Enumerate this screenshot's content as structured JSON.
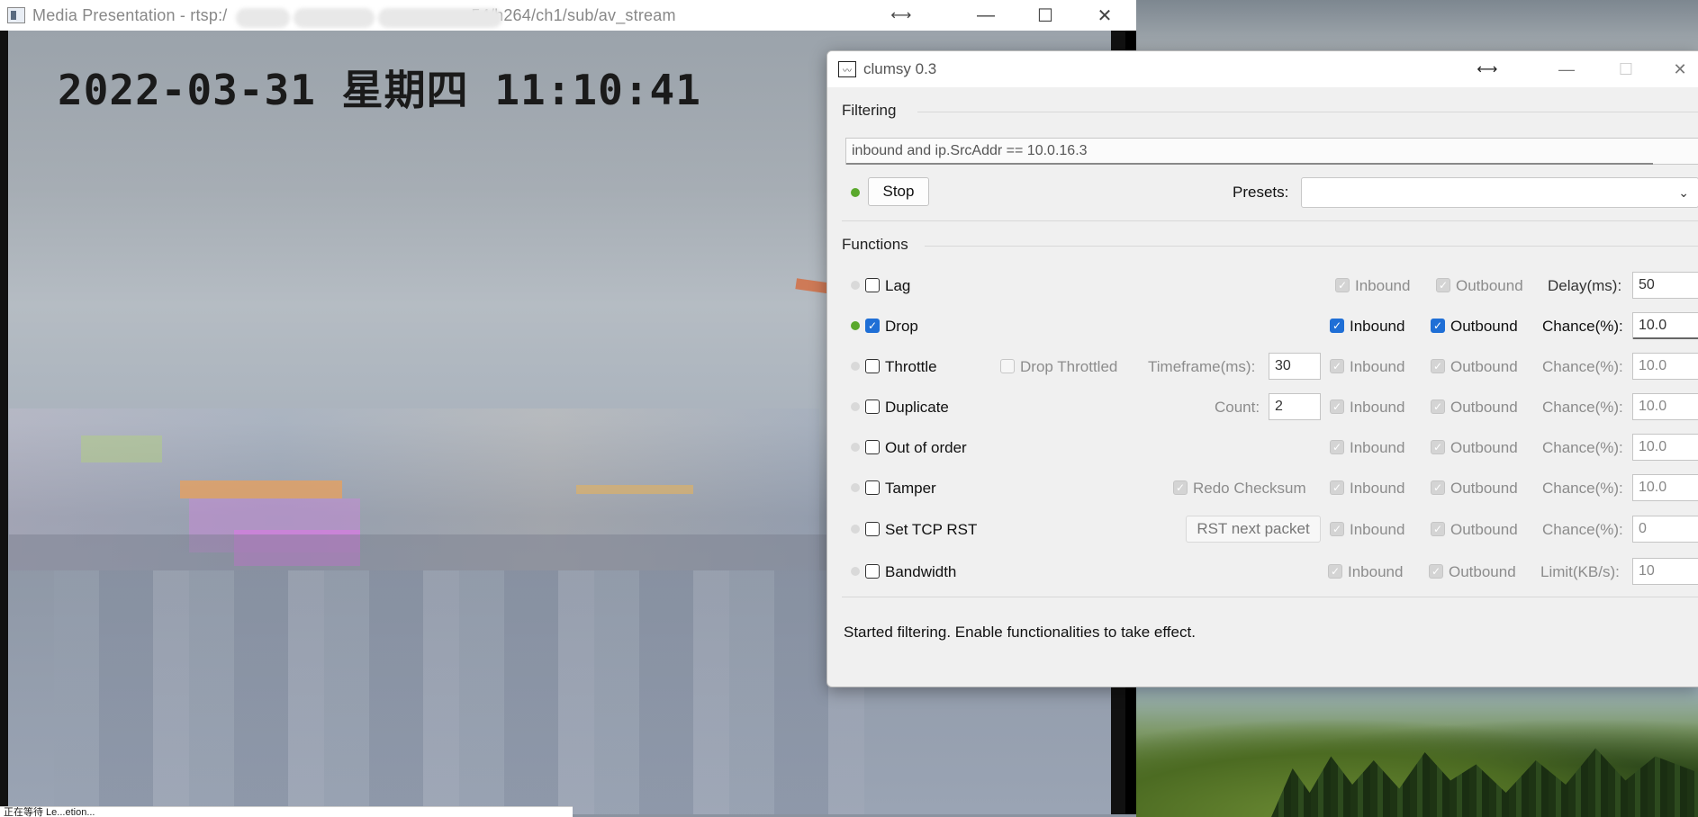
{
  "media_window": {
    "title_prefix": "Media Presentation - rtsp:/",
    "title_suffix": "54/h264/ch1/sub/av_stream",
    "overlay": "2022-03-31 星期四 11:10:41",
    "status_tip": "正在等待 Le...etion..."
  },
  "clumsy": {
    "title": "clumsy 0.3",
    "filtering_label": "Filtering",
    "filter_value": "inbound and ip.SrcAddr == 10.0.16.3",
    "stop_label": "Stop",
    "presets_label": "Presets:",
    "presets_value": "",
    "functions_label": "Functions",
    "inbound_label": "Inbound",
    "outbound_label": "Outbound",
    "functions": [
      {
        "name": "Lag",
        "enabled": false,
        "param_label": "Delay(ms):",
        "param_value": "50"
      },
      {
        "name": "Drop",
        "enabled": true,
        "param_label": "Chance(%):",
        "param_value": "10.0"
      },
      {
        "name": "Throttle",
        "enabled": false,
        "extra_label": "Drop Throttled",
        "extra_label2": "Timeframe(ms):",
        "extra_value": "30",
        "param_label": "Chance(%):",
        "param_value": "10.0"
      },
      {
        "name": "Duplicate",
        "enabled": false,
        "extra_label2": "Count:",
        "extra_value": "2",
        "param_label": "Chance(%):",
        "param_value": "10.0"
      },
      {
        "name": "Out of order",
        "enabled": false,
        "param_label": "Chance(%):",
        "param_value": "10.0"
      },
      {
        "name": "Tamper",
        "enabled": false,
        "extra_label": "Redo Checksum",
        "param_label": "Chance(%):",
        "param_value": "10.0"
      },
      {
        "name": "Set TCP RST",
        "enabled": false,
        "extra_button": "RST next packet",
        "param_label": "Chance(%):",
        "param_value": "0"
      },
      {
        "name": "Bandwidth",
        "enabled": false,
        "param_label": "Limit(KB/s):",
        "param_value": "10"
      }
    ],
    "status": "Started filtering. Enable functionalities to take effect."
  },
  "colors": {
    "accent": "#1f6fd6",
    "active_dot": "#5aa82c",
    "inactive_dot": "#d9d9d9"
  }
}
